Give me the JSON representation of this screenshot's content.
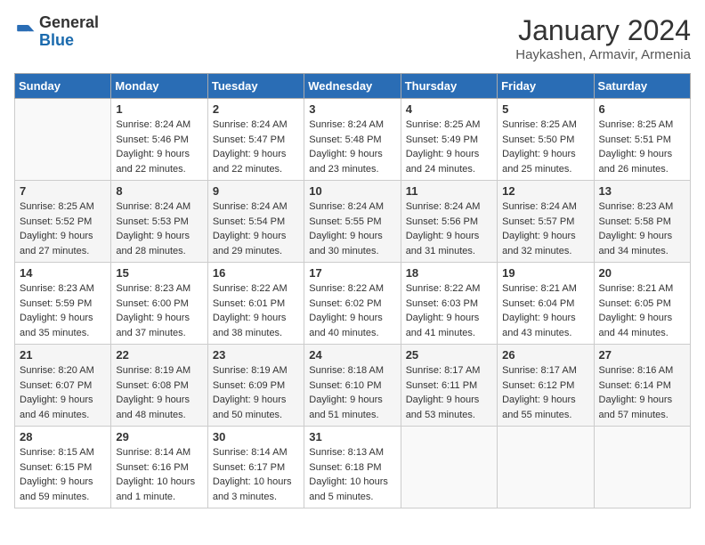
{
  "header": {
    "logo_general": "General",
    "logo_blue": "Blue",
    "month_title": "January 2024",
    "subtitle": "Haykashen, Armavir, Armenia"
  },
  "weekdays": [
    "Sunday",
    "Monday",
    "Tuesday",
    "Wednesday",
    "Thursday",
    "Friday",
    "Saturday"
  ],
  "weeks": [
    [
      {
        "day": "",
        "sunrise": "",
        "sunset": "",
        "daylight": ""
      },
      {
        "day": "1",
        "sunrise": "Sunrise: 8:24 AM",
        "sunset": "Sunset: 5:46 PM",
        "daylight": "Daylight: 9 hours and 22 minutes."
      },
      {
        "day": "2",
        "sunrise": "Sunrise: 8:24 AM",
        "sunset": "Sunset: 5:47 PM",
        "daylight": "Daylight: 9 hours and 22 minutes."
      },
      {
        "day": "3",
        "sunrise": "Sunrise: 8:24 AM",
        "sunset": "Sunset: 5:48 PM",
        "daylight": "Daylight: 9 hours and 23 minutes."
      },
      {
        "day": "4",
        "sunrise": "Sunrise: 8:25 AM",
        "sunset": "Sunset: 5:49 PM",
        "daylight": "Daylight: 9 hours and 24 minutes."
      },
      {
        "day": "5",
        "sunrise": "Sunrise: 8:25 AM",
        "sunset": "Sunset: 5:50 PM",
        "daylight": "Daylight: 9 hours and 25 minutes."
      },
      {
        "day": "6",
        "sunrise": "Sunrise: 8:25 AM",
        "sunset": "Sunset: 5:51 PM",
        "daylight": "Daylight: 9 hours and 26 minutes."
      }
    ],
    [
      {
        "day": "7",
        "sunrise": "Sunrise: 8:25 AM",
        "sunset": "Sunset: 5:52 PM",
        "daylight": "Daylight: 9 hours and 27 minutes."
      },
      {
        "day": "8",
        "sunrise": "Sunrise: 8:24 AM",
        "sunset": "Sunset: 5:53 PM",
        "daylight": "Daylight: 9 hours and 28 minutes."
      },
      {
        "day": "9",
        "sunrise": "Sunrise: 8:24 AM",
        "sunset": "Sunset: 5:54 PM",
        "daylight": "Daylight: 9 hours and 29 minutes."
      },
      {
        "day": "10",
        "sunrise": "Sunrise: 8:24 AM",
        "sunset": "Sunset: 5:55 PM",
        "daylight": "Daylight: 9 hours and 30 minutes."
      },
      {
        "day": "11",
        "sunrise": "Sunrise: 8:24 AM",
        "sunset": "Sunset: 5:56 PM",
        "daylight": "Daylight: 9 hours and 31 minutes."
      },
      {
        "day": "12",
        "sunrise": "Sunrise: 8:24 AM",
        "sunset": "Sunset: 5:57 PM",
        "daylight": "Daylight: 9 hours and 32 minutes."
      },
      {
        "day": "13",
        "sunrise": "Sunrise: 8:23 AM",
        "sunset": "Sunset: 5:58 PM",
        "daylight": "Daylight: 9 hours and 34 minutes."
      }
    ],
    [
      {
        "day": "14",
        "sunrise": "Sunrise: 8:23 AM",
        "sunset": "Sunset: 5:59 PM",
        "daylight": "Daylight: 9 hours and 35 minutes."
      },
      {
        "day": "15",
        "sunrise": "Sunrise: 8:23 AM",
        "sunset": "Sunset: 6:00 PM",
        "daylight": "Daylight: 9 hours and 37 minutes."
      },
      {
        "day": "16",
        "sunrise": "Sunrise: 8:22 AM",
        "sunset": "Sunset: 6:01 PM",
        "daylight": "Daylight: 9 hours and 38 minutes."
      },
      {
        "day": "17",
        "sunrise": "Sunrise: 8:22 AM",
        "sunset": "Sunset: 6:02 PM",
        "daylight": "Daylight: 9 hours and 40 minutes."
      },
      {
        "day": "18",
        "sunrise": "Sunrise: 8:22 AM",
        "sunset": "Sunset: 6:03 PM",
        "daylight": "Daylight: 9 hours and 41 minutes."
      },
      {
        "day": "19",
        "sunrise": "Sunrise: 8:21 AM",
        "sunset": "Sunset: 6:04 PM",
        "daylight": "Daylight: 9 hours and 43 minutes."
      },
      {
        "day": "20",
        "sunrise": "Sunrise: 8:21 AM",
        "sunset": "Sunset: 6:05 PM",
        "daylight": "Daylight: 9 hours and 44 minutes."
      }
    ],
    [
      {
        "day": "21",
        "sunrise": "Sunrise: 8:20 AM",
        "sunset": "Sunset: 6:07 PM",
        "daylight": "Daylight: 9 hours and 46 minutes."
      },
      {
        "day": "22",
        "sunrise": "Sunrise: 8:19 AM",
        "sunset": "Sunset: 6:08 PM",
        "daylight": "Daylight: 9 hours and 48 minutes."
      },
      {
        "day": "23",
        "sunrise": "Sunrise: 8:19 AM",
        "sunset": "Sunset: 6:09 PM",
        "daylight": "Daylight: 9 hours and 50 minutes."
      },
      {
        "day": "24",
        "sunrise": "Sunrise: 8:18 AM",
        "sunset": "Sunset: 6:10 PM",
        "daylight": "Daylight: 9 hours and 51 minutes."
      },
      {
        "day": "25",
        "sunrise": "Sunrise: 8:17 AM",
        "sunset": "Sunset: 6:11 PM",
        "daylight": "Daylight: 9 hours and 53 minutes."
      },
      {
        "day": "26",
        "sunrise": "Sunrise: 8:17 AM",
        "sunset": "Sunset: 6:12 PM",
        "daylight": "Daylight: 9 hours and 55 minutes."
      },
      {
        "day": "27",
        "sunrise": "Sunrise: 8:16 AM",
        "sunset": "Sunset: 6:14 PM",
        "daylight": "Daylight: 9 hours and 57 minutes."
      }
    ],
    [
      {
        "day": "28",
        "sunrise": "Sunrise: 8:15 AM",
        "sunset": "Sunset: 6:15 PM",
        "daylight": "Daylight: 9 hours and 59 minutes."
      },
      {
        "day": "29",
        "sunrise": "Sunrise: 8:14 AM",
        "sunset": "Sunset: 6:16 PM",
        "daylight": "Daylight: 10 hours and 1 minute."
      },
      {
        "day": "30",
        "sunrise": "Sunrise: 8:14 AM",
        "sunset": "Sunset: 6:17 PM",
        "daylight": "Daylight: 10 hours and 3 minutes."
      },
      {
        "day": "31",
        "sunrise": "Sunrise: 8:13 AM",
        "sunset": "Sunset: 6:18 PM",
        "daylight": "Daylight: 10 hours and 5 minutes."
      },
      {
        "day": "",
        "sunrise": "",
        "sunset": "",
        "daylight": ""
      },
      {
        "day": "",
        "sunrise": "",
        "sunset": "",
        "daylight": ""
      },
      {
        "day": "",
        "sunrise": "",
        "sunset": "",
        "daylight": ""
      }
    ]
  ]
}
